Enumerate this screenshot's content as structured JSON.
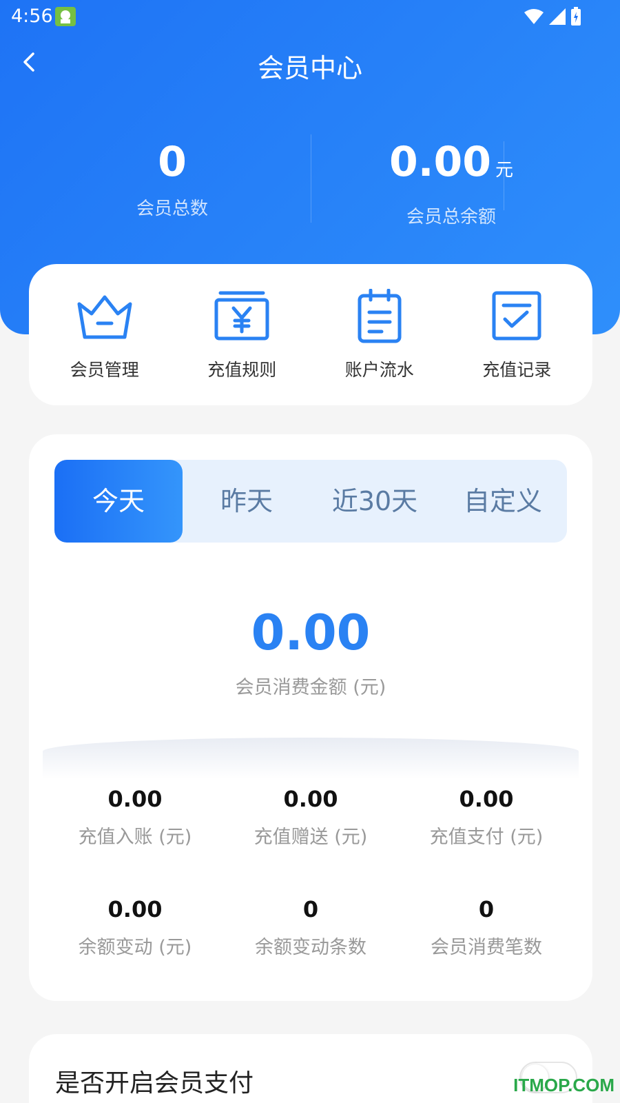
{
  "status_bar": {
    "time": "4:56"
  },
  "nav": {
    "title": "会员中心"
  },
  "summary": {
    "members_total_value": "0",
    "members_total_label": "会员总数",
    "balance_total_value": "0.00",
    "balance_total_unit": "元",
    "balance_total_label": "会员总余额"
  },
  "menu": [
    {
      "label": "会员管理",
      "icon": "crown-icon"
    },
    {
      "label": "充值规则",
      "icon": "yen-card-icon"
    },
    {
      "label": "账户流水",
      "icon": "notepad-icon"
    },
    {
      "label": "充值记录",
      "icon": "checklist-icon"
    }
  ],
  "tabs": [
    "今天",
    "昨天",
    "近30天",
    "自定义"
  ],
  "active_tab": "今天",
  "main_stat": {
    "value": "0.00",
    "label": "会员消费金额 (元)"
  },
  "stats": [
    {
      "value": "0.00",
      "label": "充值入账 (元)"
    },
    {
      "value": "0.00",
      "label": "充值赠送 (元)"
    },
    {
      "value": "0.00",
      "label": "充值支付 (元)"
    },
    {
      "value": "0.00",
      "label": "余额变动 (元)"
    },
    {
      "value": "0",
      "label": "余额变动条数"
    },
    {
      "value": "0",
      "label": "会员消费笔数"
    }
  ],
  "member_pay": {
    "label": "是否开启会员支付",
    "enabled": false
  },
  "watermark": "ITMOP.COM",
  "colors": {
    "primary": "#1e73f5",
    "accent": "#2a82f3",
    "tab_bg": "#e7f1fd"
  }
}
